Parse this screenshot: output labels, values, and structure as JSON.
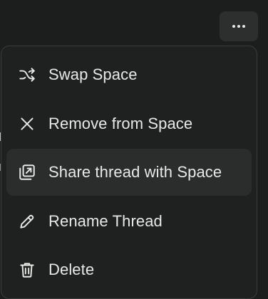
{
  "toolbar": {
    "more_icon": "ellipsis-horizontal-icon"
  },
  "menu": {
    "items": [
      {
        "label": "Swap Space",
        "icon": "shuffle-icon"
      },
      {
        "label": "Remove from Space",
        "icon": "close-icon"
      },
      {
        "label": "Share thread with Space",
        "icon": "share-to-space-icon",
        "highlighted": true
      },
      {
        "label": "Rename Thread",
        "icon": "pencil-icon"
      },
      {
        "label": "Delete",
        "icon": "trash-icon"
      }
    ]
  }
}
